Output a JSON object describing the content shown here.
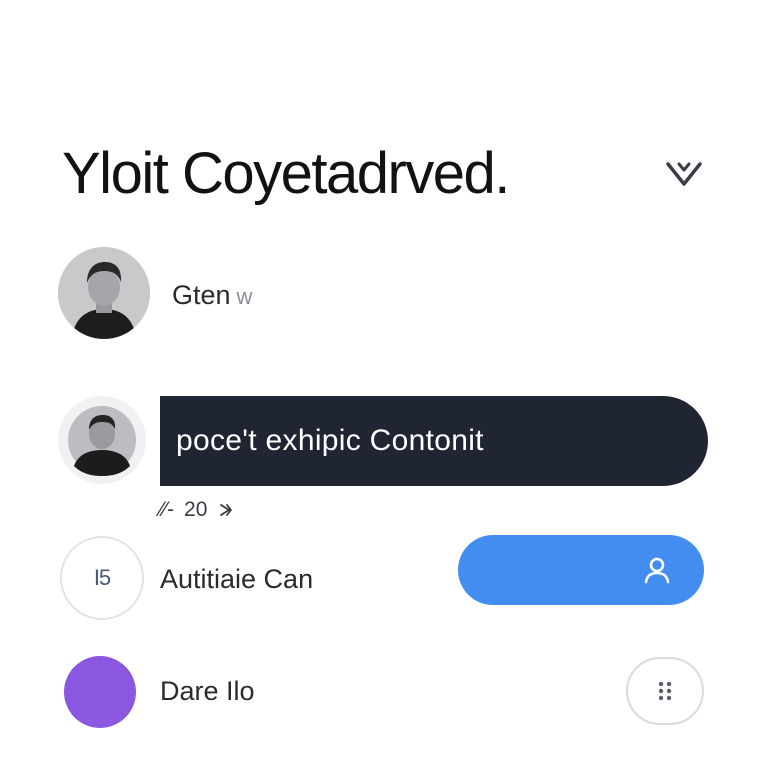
{
  "header": {
    "title": "Yloit Coyetadrved.",
    "dropdown_icon": "chevron-down-icon"
  },
  "contacts": [
    {
      "name": "Gten",
      "suffix": "w",
      "avatar": "photo"
    },
    {
      "name": "Autitiaie Can",
      "avatar_icon": "app-badge-icon",
      "avatar_glyph": "I5"
    },
    {
      "name": "Dare Ilo",
      "avatar_color": "#8b56e0"
    }
  ],
  "message": {
    "text": "poce't exhipic Contonit",
    "meta_glyph": "⁄⁄-",
    "count": "20",
    "meta_icon": "reply-icon"
  },
  "actions": {
    "primary_icon": "user-icon",
    "more_icon": "grid-dots-icon"
  },
  "colors": {
    "bubble": "#202534",
    "primary": "#438df0",
    "avatar_purple": "#8b56e0"
  }
}
